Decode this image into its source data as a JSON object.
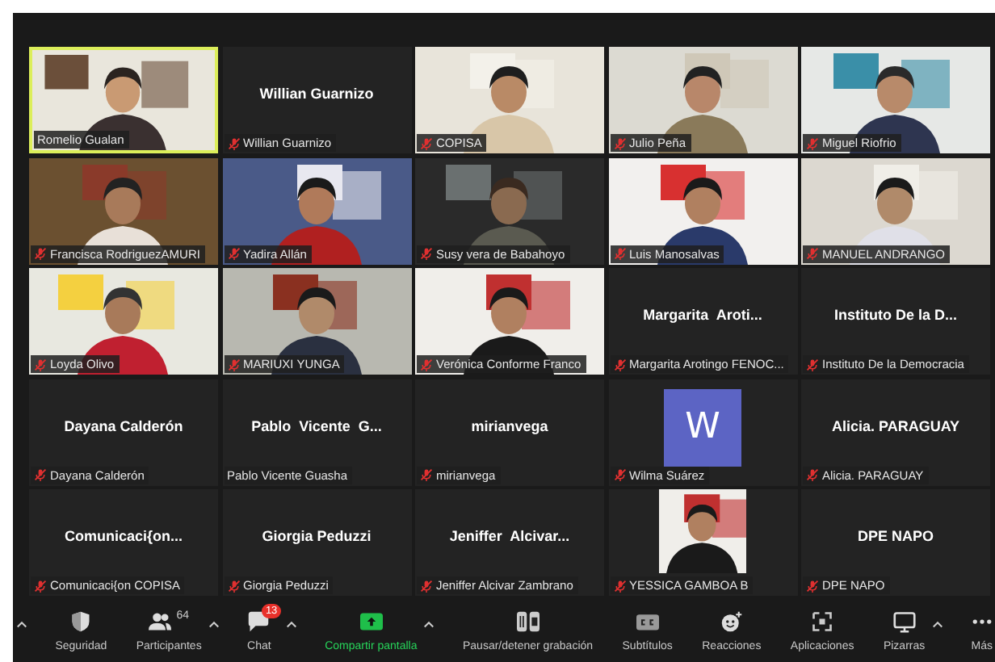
{
  "tiles": [
    {
      "kind": "video",
      "label": "Romelio Gualan",
      "muted": false,
      "active": true
    },
    {
      "kind": "name",
      "display_name": "Willian Guarnizo",
      "label": "Willian Guarnizo",
      "muted": true,
      "active": false
    },
    {
      "kind": "video",
      "label": "COPISA",
      "muted": true,
      "active": false
    },
    {
      "kind": "video",
      "label": "Julio Peña",
      "muted": true,
      "active": false
    },
    {
      "kind": "video",
      "label": "Miguel Riofrio",
      "muted": true,
      "active": false
    },
    {
      "kind": "video",
      "label": "Francisca RodriguezAMURI",
      "muted": true,
      "active": false
    },
    {
      "kind": "video",
      "label": "Yadira Allán",
      "muted": true,
      "active": false
    },
    {
      "kind": "video",
      "label": "Susy vera de Babahoyo",
      "muted": true,
      "active": false
    },
    {
      "kind": "video",
      "label": "Luis Manosalvas",
      "muted": true,
      "active": false
    },
    {
      "kind": "video",
      "label": "MANUEL ANDRANGO",
      "muted": true,
      "active": false
    },
    {
      "kind": "video",
      "label": "Loyda Olivo",
      "muted": true,
      "active": false
    },
    {
      "kind": "video",
      "label": "MARIUXI YUNGA",
      "muted": true,
      "active": false
    },
    {
      "kind": "video",
      "label": "Verónica Conforme Franco",
      "muted": true,
      "active": false
    },
    {
      "kind": "name",
      "display_name": "Margarita  Aroti...",
      "label": "Margarita Arotingo FENOC...",
      "muted": true,
      "active": false
    },
    {
      "kind": "name",
      "display_name": "Instituto De la D...",
      "label": "Instituto De la Democracia",
      "muted": true,
      "active": false
    },
    {
      "kind": "name",
      "display_name": "Dayana Calderón",
      "label": "Dayana Calderón",
      "muted": true,
      "active": false
    },
    {
      "kind": "name",
      "display_name": "Pablo  Vicente  G...",
      "label": "Pablo Vicente Guasha",
      "muted": false,
      "active": false
    },
    {
      "kind": "name",
      "display_name": "mirianvega",
      "label": "mirianvega",
      "muted": true,
      "active": false
    },
    {
      "kind": "letter",
      "letter": "W",
      "label": "Wilma Suárez",
      "muted": true,
      "active": false
    },
    {
      "kind": "name",
      "display_name": "Alicia. PARAGUAY",
      "label": "Alicia. PARAGUAY",
      "muted": true,
      "active": false
    },
    {
      "kind": "name",
      "display_name": "Comunicaci{on...",
      "label": "Comunicaci{on COPISA",
      "muted": true,
      "active": false
    },
    {
      "kind": "name",
      "display_name": "Giorgia Peduzzi",
      "label": "Giorgia Peduzzi",
      "muted": true,
      "active": false
    },
    {
      "kind": "name",
      "display_name": "Jeniffer  Alcivar...",
      "label": "Jeniffer Alcivar Zambrano",
      "muted": true,
      "active": false
    },
    {
      "label": "YESSICA GAMBOA B",
      "muted": true,
      "active": false
    },
    {
      "kind": "name",
      "display_name": "DPE NAPO",
      "label": "DPE NAPO",
      "muted": true,
      "active": false
    }
  ],
  "toolbar": {
    "overflow_caret": true,
    "items": [
      {
        "kind": "security",
        "label": "Seguridad",
        "caret": false
      },
      {
        "kind": "participants",
        "label": "Participantes",
        "count": "64",
        "caret": true
      },
      {
        "kind": "chat",
        "label": "Chat",
        "badge": "13",
        "caret": true
      },
      {
        "kind": "share",
        "label": "Compartir pantalla",
        "caret": true
      },
      {
        "kind": "record",
        "label": "Pausar/detener grabación",
        "caret": false
      },
      {
        "kind": "captions",
        "label": "Subtítulos",
        "caret": false
      },
      {
        "kind": "reactions",
        "label": "Reacciones",
        "caret": false
      },
      {
        "kind": "apps",
        "label": "Aplicaciones",
        "caret": false
      },
      {
        "kind": "whiteboard",
        "label": "Pizarras",
        "caret": true
      },
      {
        "kind": "more",
        "label": "Más",
        "caret": false
      }
    ]
  }
}
